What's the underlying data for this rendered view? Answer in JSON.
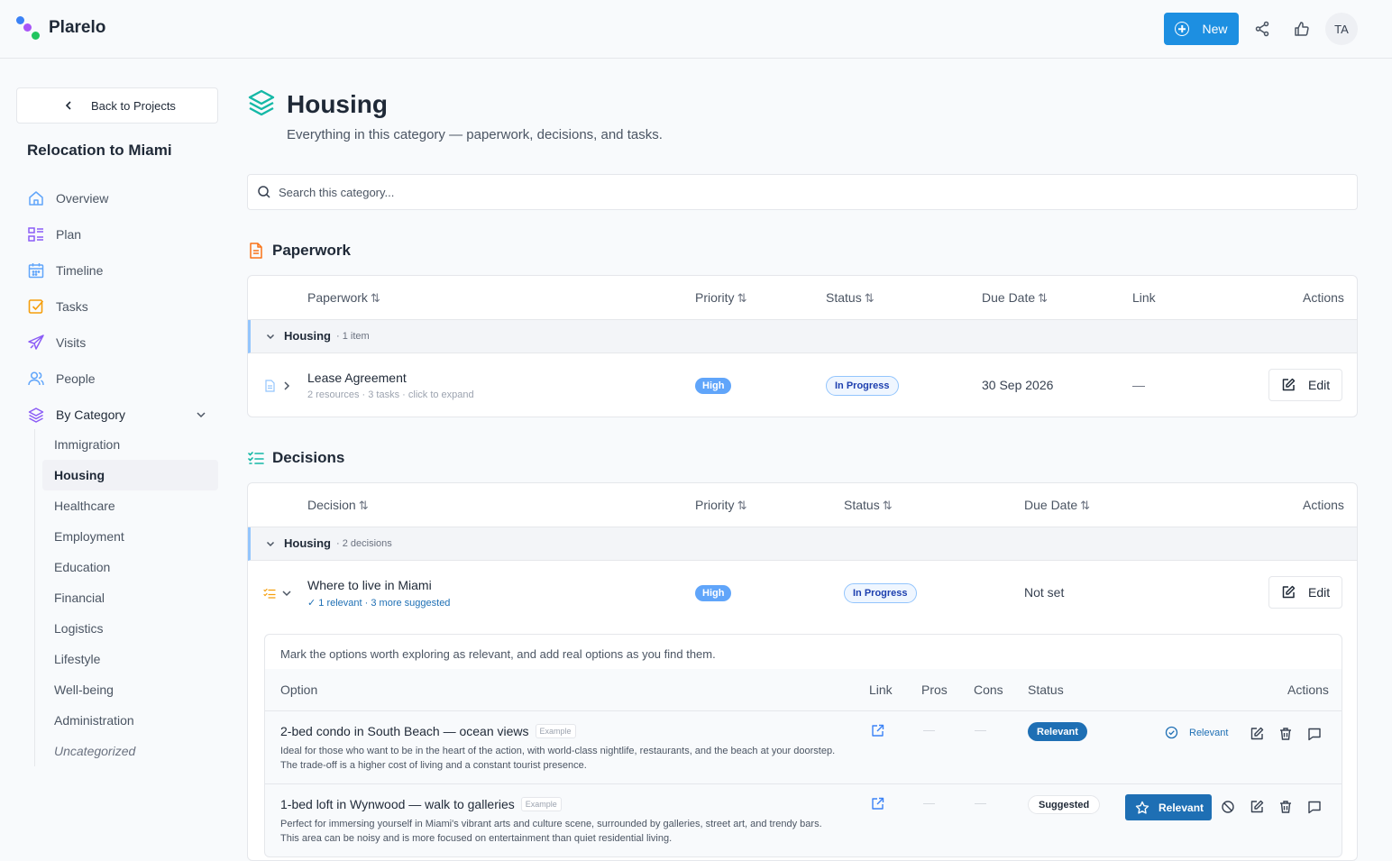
{
  "app": {
    "name": "Plarelo",
    "new_label": "New",
    "avatar_initials": "TA"
  },
  "sidebar": {
    "back_label": "Back to Projects",
    "project_title": "Relocation to Miami",
    "nav": [
      {
        "label": "Overview",
        "icon": "home-icon"
      },
      {
        "label": "Plan",
        "icon": "list-icon"
      },
      {
        "label": "Timeline",
        "icon": "calendar-icon"
      },
      {
        "label": "Tasks",
        "icon": "checkbox-icon"
      },
      {
        "label": "Visits",
        "icon": "plane-icon"
      },
      {
        "label": "People",
        "icon": "people-icon"
      },
      {
        "label": "By Category",
        "icon": "layers-icon"
      }
    ],
    "categories": [
      "Immigration",
      "Housing",
      "Healthcare",
      "Employment",
      "Education",
      "Financial",
      "Logistics",
      "Lifestyle",
      "Well-being",
      "Administration",
      "Uncategorized"
    ],
    "active_category": "Housing"
  },
  "page": {
    "title": "Housing",
    "subtitle": "Everything in this category — paperwork, decisions, and tasks.",
    "search_placeholder": "Search this category..."
  },
  "paperwork": {
    "section_title": "Paperwork",
    "columns": {
      "name": "Paperwork",
      "priority": "Priority",
      "status": "Status",
      "due": "Due Date",
      "link": "Link",
      "actions": "Actions"
    },
    "group": {
      "name": "Housing",
      "count": "· 1 item"
    },
    "rows": [
      {
        "title": "Lease Agreement",
        "meta": "2 resources · 3 tasks · click to expand",
        "priority": "High",
        "status": "In Progress",
        "due": "30 Sep 2026",
        "link": "—",
        "edit": "Edit"
      }
    ]
  },
  "decisions": {
    "section_title": "Decisions",
    "columns": {
      "name": "Decision",
      "priority": "Priority",
      "status": "Status",
      "due": "Due Date",
      "actions": "Actions"
    },
    "group": {
      "name": "Housing",
      "count": "· 2 decisions"
    },
    "rows": [
      {
        "title": "Where to live in Miami",
        "meta_relevant": "✓ 1 relevant",
        "meta_sep": " · ",
        "meta_suggested": "3 more suggested",
        "priority": "High",
        "status": "In Progress",
        "due": "Not set",
        "edit": "Edit"
      }
    ],
    "options_intro": "Mark the options worth exploring as relevant, and add real options as you find them.",
    "option_columns": {
      "option": "Option",
      "link": "Link",
      "pros": "Pros",
      "cons": "Cons",
      "status": "Status",
      "actions": "Actions"
    },
    "options": [
      {
        "title": "2-bed condo in South Beach — ocean views",
        "tag": "Example",
        "desc": "Ideal for those who want to be in the heart of the action, with world-class nightlife, restaurants, and the beach at your doorstep. The trade-off is a higher cost of living and a constant tourist presence.",
        "pros": "—",
        "cons": "—",
        "status": "Relevant",
        "action_label": "Relevant"
      },
      {
        "title": "1-bed loft in Wynwood — walk to galleries",
        "tag": "Example",
        "desc": "Perfect for immersing yourself in Miami's vibrant arts and culture scene, surrounded by galleries, street art, and trendy bars. This area can be noisy and is more focused on entertainment than quiet residential living.",
        "pros": "—",
        "cons": "—",
        "status": "Suggested",
        "action_label": "Relevant"
      }
    ]
  },
  "colors": {
    "accent": "#1d8fe1",
    "relevant": "#1e6fb4",
    "priority_high": "#60a5fa"
  }
}
